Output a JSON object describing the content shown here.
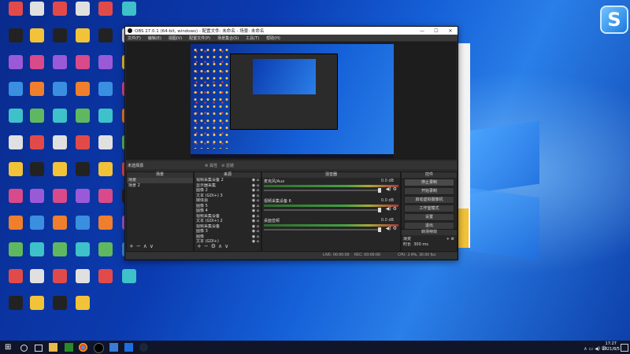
{
  "desktop": {
    "wallpaper_colors": [
      "#0a2a8c",
      "#1560d8",
      "#2a7fe8"
    ]
  },
  "obs": {
    "title": "OBS 27.0.1 (64-bit, windows) - 配置文件: 未命名 - 场景: 未命名",
    "menu": [
      "文件(F)",
      "编辑(E)",
      "视图(V)",
      "配置文件(P)",
      "场景集合(S)",
      "工具(T)",
      "帮助(H)"
    ],
    "no_scene_selected": "未选择源",
    "properties_label": "属性",
    "filters_label": "滤镜",
    "panels": {
      "scenes": "场景",
      "sources": "来源",
      "mixer": "混音器",
      "controls": "控件",
      "transitions": "转场特效"
    },
    "scenes": [
      "场景",
      "场景 2"
    ],
    "sources": [
      "视频采集设备 2",
      "显示器采集",
      "图像 2",
      "文本 (GDI+) 3",
      "媒体源",
      "图像 5",
      "图像 4",
      "视频采集设备",
      "文本 (GDI+) 2",
      "视频采集设备",
      "图像 3",
      "图像",
      "文本 (GDI+)"
    ],
    "mixer_tracks": [
      {
        "name": "麦克风/Aux",
        "db": "0.0 dB"
      },
      {
        "name": "视频采集设备 6",
        "db": "0.0 dB"
      },
      {
        "name": "桌面音频",
        "db": "0.0 dB"
      }
    ],
    "controls": [
      "停止录制",
      "开始录制",
      "启动虚拟摄像机",
      "工作室模式",
      "设置",
      "退出"
    ],
    "transitions": {
      "type": "渐变",
      "duration_label": "时长",
      "duration_value": "300 ms"
    },
    "status": {
      "live": "LIVE: 00:00:00",
      "rec": "REC: 00:00:00",
      "cpu": "CPU: 3.9%, 30.00 fps"
    }
  },
  "taskbar": {
    "time": "17:27",
    "date": "2021/8/5"
  }
}
